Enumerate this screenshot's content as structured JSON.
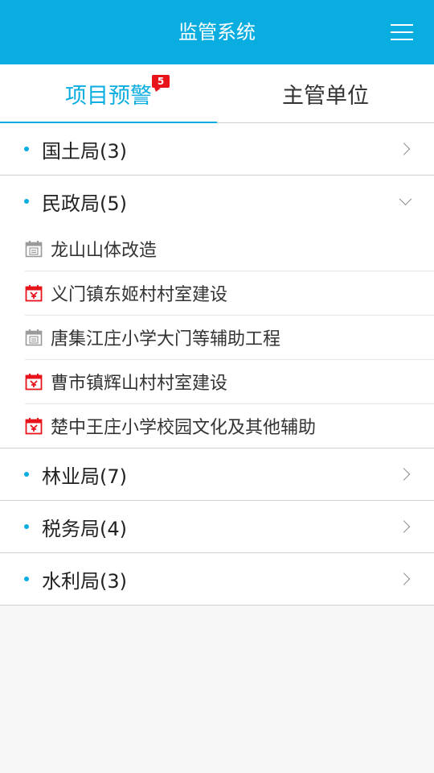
{
  "header": {
    "title": "监管系统",
    "menu_icon": "hamburger-menu-icon"
  },
  "tabs": [
    {
      "label": "项目预警",
      "badge": "5",
      "active": true
    },
    {
      "label": "主管单位",
      "active": false
    }
  ],
  "departments": [
    {
      "name": "国土局(3)",
      "expanded": false
    },
    {
      "name": "民政局(5)",
      "expanded": true,
      "projects": [
        {
          "name": "龙山山体改造",
          "status_icon": "calendar-normal-icon"
        },
        {
          "name": "义门镇东姬村村室建设",
          "status_icon": "calendar-warning-icon"
        },
        {
          "name": "唐集江庄小学大门等辅助工程",
          "status_icon": "calendar-normal-icon"
        },
        {
          "name": "曹市镇辉山村村室建设",
          "status_icon": "calendar-warning-icon"
        },
        {
          "name": "楚中王庄小学校园文化及其他辅助",
          "status_icon": "calendar-warning-icon"
        }
      ]
    },
    {
      "name": "林业局(7)",
      "expanded": false
    },
    {
      "name": "税务局(4)",
      "expanded": false
    },
    {
      "name": "水利局(3)",
      "expanded": false
    }
  ],
  "colors": {
    "accent": "#0aade0",
    "warning": "#e8141b",
    "normal_icon": "#9a9a9a"
  }
}
